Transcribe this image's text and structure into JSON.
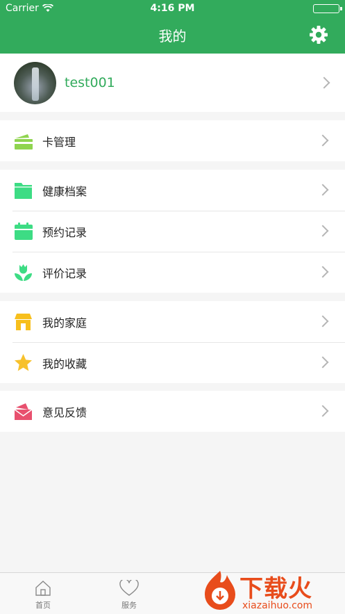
{
  "status_bar": {
    "carrier": "Carrier",
    "time": "4:16 PM"
  },
  "nav": {
    "title": "我的"
  },
  "profile": {
    "username": "test001"
  },
  "groups": [
    {
      "items": [
        {
          "label": "卡管理",
          "icon": "card-icon"
        }
      ]
    },
    {
      "items": [
        {
          "label": "健康档案",
          "icon": "folder-icon"
        },
        {
          "label": "预约记录",
          "icon": "calendar-icon"
        },
        {
          "label": "评价记录",
          "icon": "tulip-icon"
        }
      ]
    },
    {
      "items": [
        {
          "label": "我的家庭",
          "icon": "house-icon"
        },
        {
          "label": "我的收藏",
          "icon": "star-icon"
        }
      ]
    },
    {
      "items": [
        {
          "label": "意见反馈",
          "icon": "envelope-icon"
        }
      ]
    }
  ],
  "tabs": [
    {
      "label": "首页",
      "icon": "home-icon"
    },
    {
      "label": "服务",
      "icon": "heart-icon"
    }
  ],
  "watermark": {
    "title": "下载火",
    "url": "xiazaihuo.com"
  },
  "colors": {
    "primary": "#32ab5c",
    "card": "#8fd44f",
    "health": "#3ddc84",
    "home": "#f7bf1c",
    "star": "#f7c12c",
    "feedback": "#e8506e",
    "watermark": "#e84c1b"
  }
}
